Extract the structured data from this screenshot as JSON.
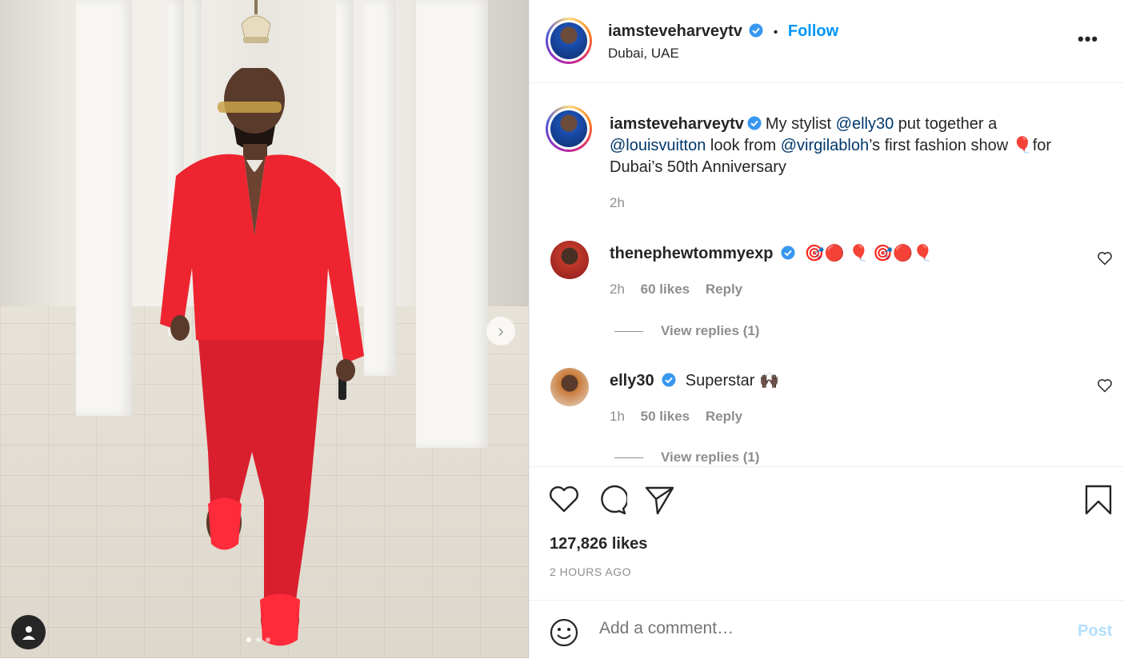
{
  "post": {
    "username": "iamsteveharveytv",
    "separator": "•",
    "follow_label": "Follow",
    "location": "Dubai, UAE",
    "more_label": "•••"
  },
  "caption": {
    "username": "iamsteveharveytv",
    "text_1": "My stylist ",
    "mention_1": "@elly30",
    "text_2": " put together a ",
    "mention_2": "@louisvuitton",
    "text_3": " look from ",
    "mention_3": "@virgilabloh",
    "text_4": "’s first fashion show ",
    "emoji_1": "🎈",
    "text_5": "for Dubai’s 50th Anniversary",
    "time": "2h"
  },
  "comments": [
    {
      "username": "thenephewtommyexp",
      "text": "🎯🔴 🎈 🎯🔴🎈",
      "time": "2h",
      "likes": "60 likes",
      "reply_label": "Reply",
      "view_replies": "View replies (1)"
    },
    {
      "username": "elly30",
      "text": "Superstar 🙌🏿",
      "time": "1h",
      "likes": "50 likes",
      "reply_label": "Reply",
      "view_replies": "View replies (1)"
    }
  ],
  "stats": {
    "likes": "127,826 likes",
    "time": "2 HOURS AGO"
  },
  "composer": {
    "placeholder": "Add a comment…",
    "post_label": "Post"
  },
  "carousel": {
    "next_icon": "chevron-right",
    "slides": 3,
    "active_slide": 1
  },
  "colors": {
    "accent": "#0095f6",
    "mention": "#00376b",
    "muted": "#8e8e8e",
    "outfit": "#e8242f"
  },
  "icons": [
    "verified-icon",
    "more-icon",
    "heart-icon",
    "comment-icon",
    "share-icon",
    "bookmark-icon",
    "emoji-icon",
    "user-tag-icon",
    "chevron-right-icon"
  ]
}
